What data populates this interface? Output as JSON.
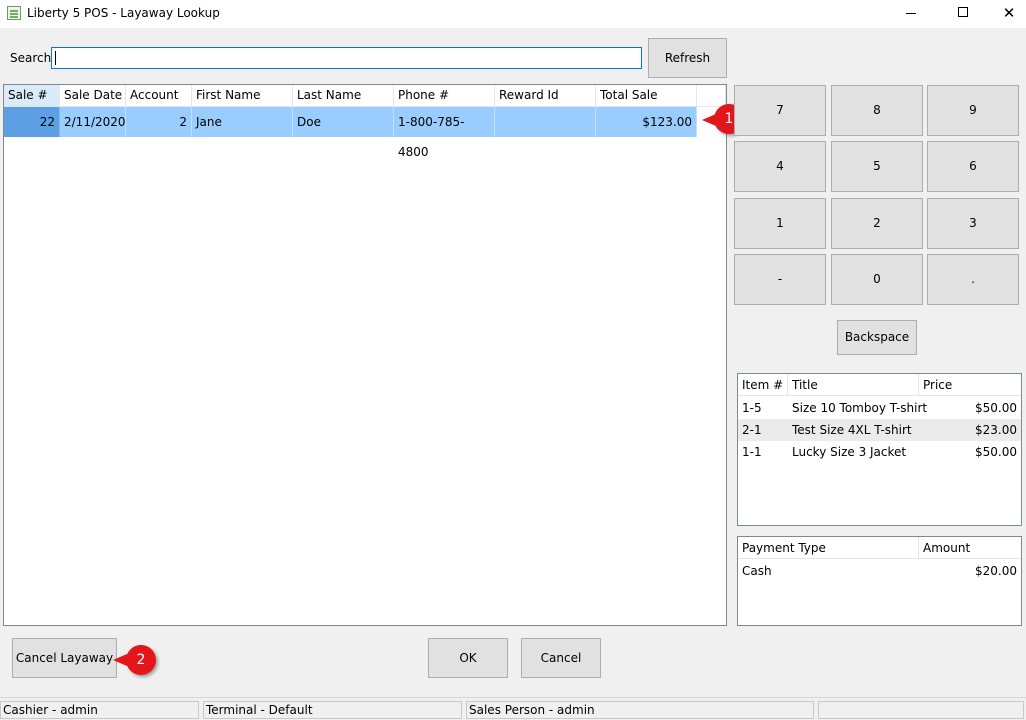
{
  "window": {
    "title": "Liberty 5 POS - Layaway Lookup",
    "controls": {
      "minimize": "",
      "maximize": "",
      "close": "✕"
    }
  },
  "search": {
    "label": "Search",
    "value": "",
    "refresh_label": "Refresh"
  },
  "layaways": {
    "columns": [
      "Sale #",
      "Sale Date",
      "Account #",
      "First Name",
      "Last Name",
      "Phone #",
      "Reward Id",
      "Total Sale"
    ],
    "rows": [
      {
        "sale_no": "22",
        "sale_date": "2/11/2020",
        "account_no": "2",
        "first_name": "Jane",
        "last_name": "Doe",
        "phone": "1-800-785-4800",
        "reward_id": "",
        "total_sale": "$123.00",
        "selected": true
      }
    ]
  },
  "callouts": [
    "1",
    "2"
  ],
  "keypad": {
    "keys": [
      "7",
      "8",
      "9",
      "4",
      "5",
      "6",
      "1",
      "2",
      "3",
      "-",
      "0",
      "."
    ],
    "backspace_label": "Backspace"
  },
  "items": {
    "columns": [
      "Item #",
      "Title",
      "Price"
    ],
    "rows": [
      {
        "item_no": "1-5",
        "title": "Size 10 Tomboy T-shirt",
        "price": "$50.00"
      },
      {
        "item_no": "2-1",
        "title": "Test Size 4XL T-shirt",
        "price": "$23.00"
      },
      {
        "item_no": "1-1",
        "title": "Lucky Size 3 Jacket",
        "price": "$50.00"
      }
    ]
  },
  "payments": {
    "columns": [
      "Payment Type",
      "Amount"
    ],
    "rows": [
      {
        "type": "Cash",
        "amount": "$20.00"
      }
    ]
  },
  "actions": {
    "cancel_layaway": "Cancel Layaway",
    "ok": "OK",
    "cancel": "Cancel"
  },
  "status": {
    "cashier": "Cashier - admin",
    "terminal": "Terminal - Default",
    "sales_person": "Sales Person - admin",
    "extra": ""
  },
  "colors": {
    "selected_row": "#99ccff",
    "callout": "#e3161b",
    "focus_border": "#0078d7"
  }
}
